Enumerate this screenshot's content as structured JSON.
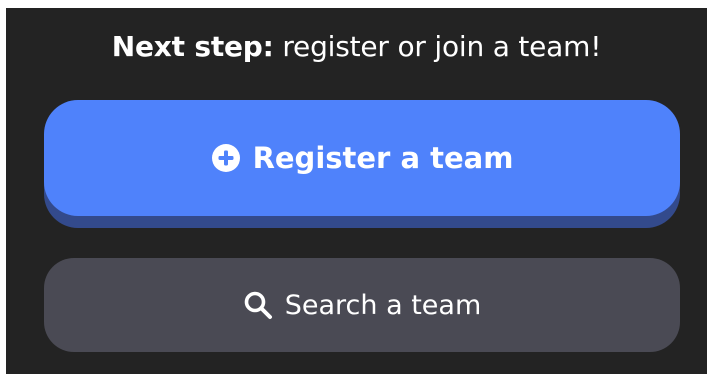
{
  "heading": {
    "strong": "Next step:",
    "rest": " register or join a team!"
  },
  "buttons": {
    "register_label": "Register a team",
    "search_label": "Search a team"
  },
  "icons": {
    "register": "plus-circle-icon",
    "search": "search-icon"
  },
  "colors": {
    "panel_bg": "#232323",
    "primary": "#4f82fb",
    "primary_shadow": "#334a8c",
    "secondary": "#4a4a54",
    "text": "#ffffff"
  }
}
